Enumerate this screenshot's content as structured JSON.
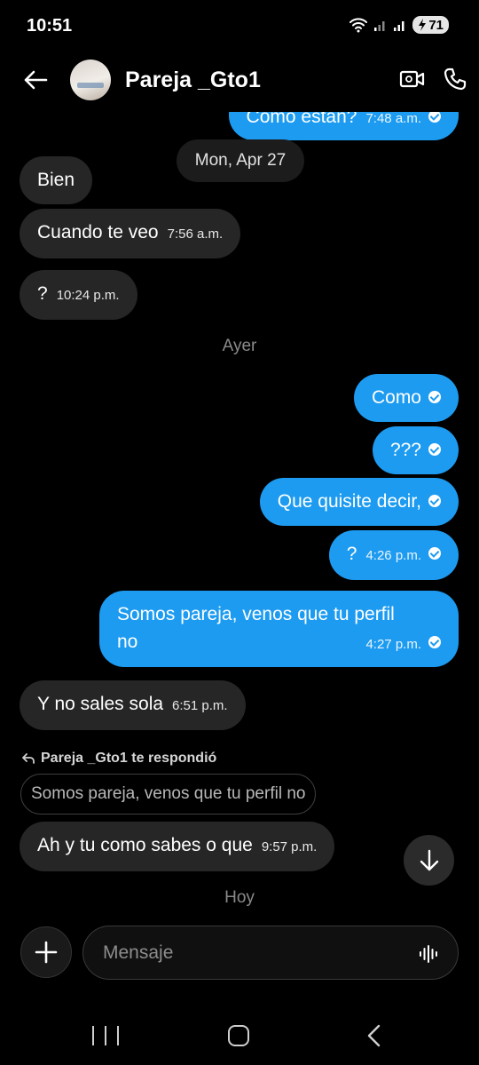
{
  "status": {
    "time": "10:51",
    "battery": "71"
  },
  "header": {
    "contact_name": "Pareja _Gto1"
  },
  "chat": {
    "partial_out": {
      "text": "Como estan?",
      "time": "7:48 a.m."
    },
    "date_pill": "Mon, Apr 27",
    "msg_bien": {
      "text": "Bien"
    },
    "msg_cuando": {
      "text": "Cuando te veo",
      "time": "7:56 a.m."
    },
    "msg_question": {
      "text": "?",
      "time": "10:24 p.m."
    },
    "divider_ayer": "Ayer",
    "msg_como": {
      "text": "Como"
    },
    "msg_qqq": {
      "text": "???"
    },
    "msg_quisite": {
      "text": "Que quisite decir,"
    },
    "msg_q2": {
      "text": "?",
      "time": "4:26 p.m."
    },
    "msg_somos": {
      "line1": "Somos pareja, venos que tu perfil",
      "line2": "no",
      "time": "4:27 p.m."
    },
    "msg_sales": {
      "text": "Y no sales sola",
      "time": "6:51 p.m."
    },
    "reply_header": "Pareja _Gto1 te respondió",
    "quoted_text": "Somos pareja, venos que tu perfil no",
    "msg_ah": {
      "text": "Ah y tu como sabes o que",
      "time": "9:57 p.m."
    },
    "divider_hoy": "Hoy"
  },
  "composer": {
    "placeholder": "Mensaje"
  },
  "colors": {
    "outgoing": "#1d9bf0",
    "incoming": "#262626",
    "background": "#000000"
  },
  "icons": [
    "back-arrow-icon",
    "video-call-icon",
    "phone-icon",
    "reply-arrow-icon",
    "arrow-down-icon",
    "plus-icon",
    "voice-wave-icon",
    "recent-apps-icon",
    "home-icon",
    "nav-back-icon",
    "wifi-icon",
    "signal-icon"
  ]
}
